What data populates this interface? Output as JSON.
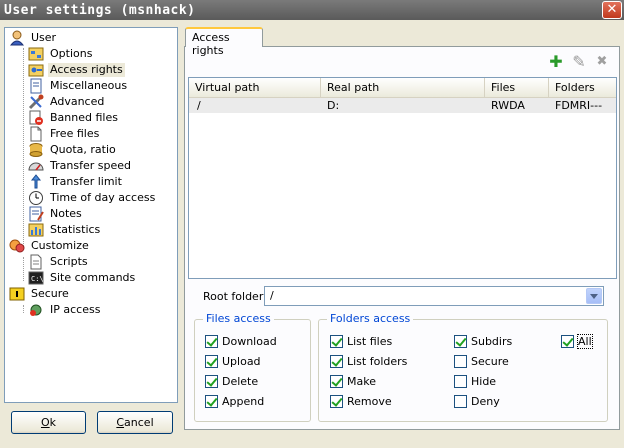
{
  "window": {
    "title": "User settings (msnhack)",
    "close_glyph": "✕"
  },
  "tree": [
    {
      "label": "User",
      "icon": "user-icon",
      "level": 0
    },
    {
      "label": "Options",
      "icon": "options-icon",
      "level": 1
    },
    {
      "label": "Access rights",
      "icon": "access-rights-icon",
      "level": 1,
      "selected": true
    },
    {
      "label": "Miscellaneous",
      "icon": "miscellaneous-icon",
      "level": 1
    },
    {
      "label": "Advanced",
      "icon": "advanced-icon",
      "level": 1
    },
    {
      "label": "Banned files",
      "icon": "banned-files-icon",
      "level": 1
    },
    {
      "label": "Free files",
      "icon": "free-files-icon",
      "level": 1
    },
    {
      "label": "Quota, ratio",
      "icon": "quota-icon",
      "level": 1
    },
    {
      "label": "Transfer speed",
      "icon": "transfer-speed-icon",
      "level": 1
    },
    {
      "label": "Transfer limit",
      "icon": "transfer-limit-icon",
      "level": 1
    },
    {
      "label": "Time of day access",
      "icon": "clock-icon",
      "level": 1
    },
    {
      "label": "Notes",
      "icon": "notes-icon",
      "level": 1
    },
    {
      "label": "Statistics",
      "icon": "statistics-icon",
      "level": 1
    },
    {
      "label": "Customize",
      "icon": "customize-icon",
      "level": 0
    },
    {
      "label": "Scripts",
      "icon": "scripts-icon",
      "level": 1
    },
    {
      "label": "Site commands",
      "icon": "site-commands-icon",
      "level": 1
    },
    {
      "label": "Secure",
      "icon": "secure-icon",
      "level": 0
    },
    {
      "label": "IP access",
      "icon": "ip-access-icon",
      "level": 1
    }
  ],
  "buttons": {
    "ok_pre": "",
    "ok_u": "O",
    "ok_post": "k",
    "cancel_pre": "",
    "cancel_u": "C",
    "cancel_post": "ancel"
  },
  "tab": {
    "label": "Access rights"
  },
  "toolbar": {
    "add_glyph": "✚",
    "edit_glyph": "✎",
    "delete_glyph": "✖"
  },
  "listview": {
    "columns": [
      "Virtual path",
      "Real path",
      "Files",
      "Folders"
    ],
    "rows": [
      {
        "virtual": "/",
        "real": "D:",
        "files": "RWDA",
        "folders": "FDMRI---"
      }
    ]
  },
  "root_folder": {
    "label": "Root folder",
    "value": "/"
  },
  "files_access": {
    "title": "Files access",
    "items": [
      {
        "label": "Download",
        "checked": true
      },
      {
        "label": "Upload",
        "checked": true
      },
      {
        "label": "Delete",
        "checked": true
      },
      {
        "label": "Append",
        "checked": true
      }
    ]
  },
  "folders_access": {
    "title": "Folders access",
    "col1": [
      {
        "label": "List files",
        "checked": true
      },
      {
        "label": "List folders",
        "checked": true
      },
      {
        "label": "Make",
        "checked": true
      },
      {
        "label": "Remove",
        "checked": true
      }
    ],
    "col2": [
      {
        "label": "Subdirs",
        "checked": true
      },
      {
        "label": "Secure",
        "checked": false
      },
      {
        "label": "Hide",
        "checked": false
      },
      {
        "label": "Deny",
        "checked": false
      }
    ],
    "all": {
      "label": "All",
      "checked": true
    }
  }
}
